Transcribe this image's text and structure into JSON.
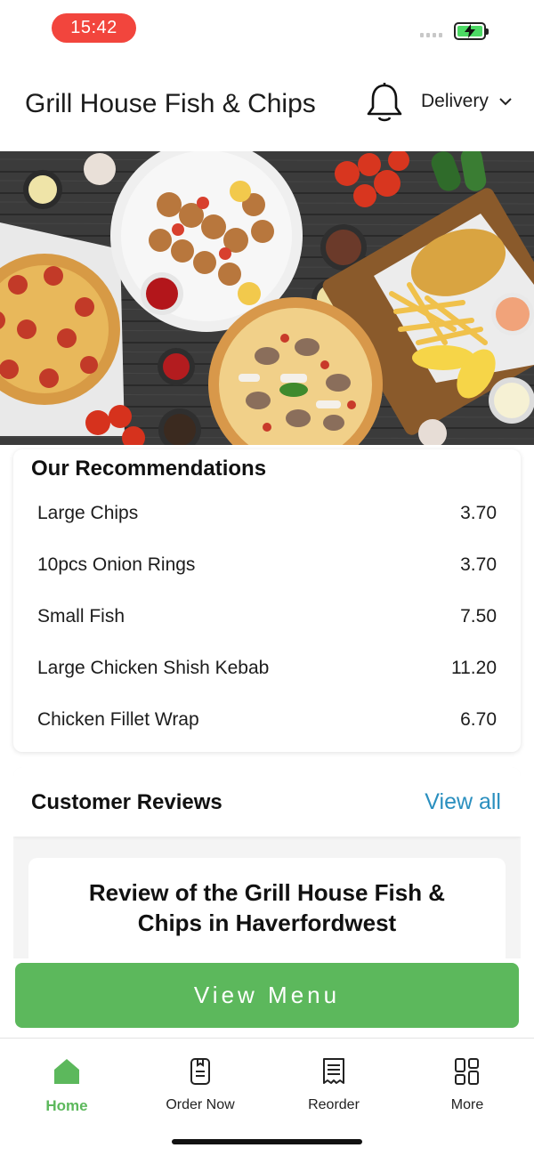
{
  "status_bar": {
    "time": "15:42"
  },
  "header": {
    "title": "Grill House Fish & Chips",
    "delivery_mode": "Delivery"
  },
  "recommendations": {
    "title": "Our Recommendations",
    "items": [
      {
        "name": "Large Chips",
        "price": "3.70"
      },
      {
        "name": "10pcs Onion Rings",
        "price": "3.70"
      },
      {
        "name": "Small Fish",
        "price": "7.50"
      },
      {
        "name": "Large Chicken Shish Kebab",
        "price": "11.20"
      },
      {
        "name": "Chicken Fillet Wrap",
        "price": "6.70"
      }
    ]
  },
  "reviews": {
    "title": "Customer Reviews",
    "view_all": "View all",
    "card_title": "Review of the Grill House Fish & Chips in Haverfordwest"
  },
  "cta": {
    "label": "View Menu"
  },
  "tabs": [
    {
      "label": "Home",
      "icon": "home-icon",
      "active": true
    },
    {
      "label": "Order Now",
      "icon": "order-icon",
      "active": false
    },
    {
      "label": "Reorder",
      "icon": "receipt-icon",
      "active": false
    },
    {
      "label": "More",
      "icon": "grid-icon",
      "active": false
    }
  ],
  "colors": {
    "accent": "#5cb85c",
    "link": "#2a8fbf",
    "time_pill": "#f2453d"
  }
}
